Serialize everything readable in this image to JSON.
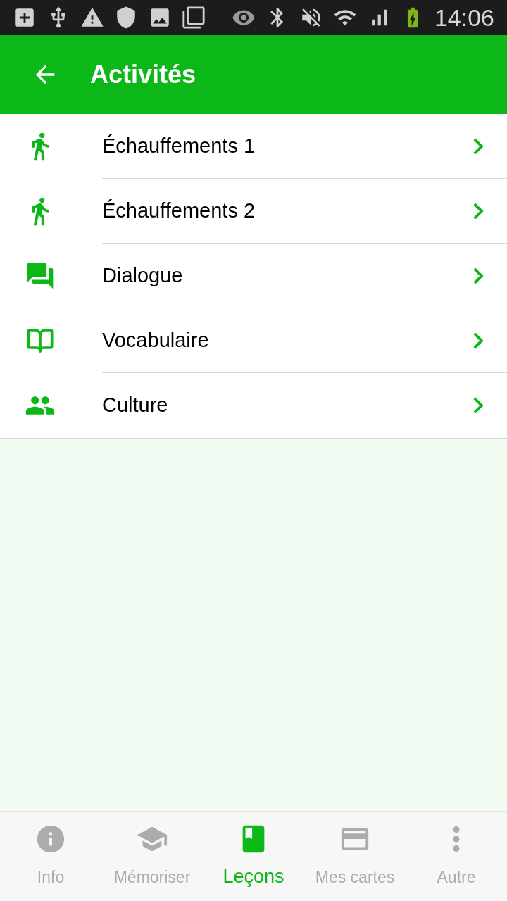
{
  "status_bar": {
    "time": "14:06"
  },
  "app_bar": {
    "title": "Activités"
  },
  "activities": [
    {
      "kind": "walk",
      "label": "Échauffements 1"
    },
    {
      "kind": "walk",
      "label": "Échauffements 2"
    },
    {
      "kind": "chat",
      "label": "Dialogue"
    },
    {
      "kind": "book",
      "label": "Vocabulaire"
    },
    {
      "kind": "people",
      "label": "Culture"
    }
  ],
  "bottom_nav": [
    {
      "kind": "info",
      "label": "Info",
      "selected": false
    },
    {
      "kind": "school",
      "label": "Mémoriser",
      "selected": false
    },
    {
      "kind": "lessons",
      "label": "Leçons",
      "selected": true
    },
    {
      "kind": "card",
      "label": "Mes cartes",
      "selected": false
    },
    {
      "kind": "more",
      "label": "Autre",
      "selected": false
    }
  ]
}
